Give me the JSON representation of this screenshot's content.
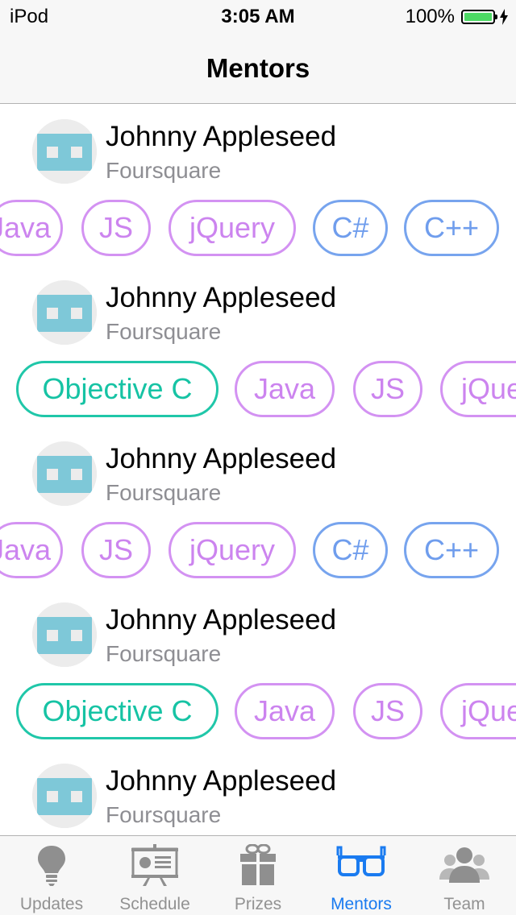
{
  "status_bar": {
    "carrier": "iPod",
    "time": "3:05 AM",
    "battery_percent": "100%",
    "battery_level": 1.0,
    "battery_color": "#4cd964"
  },
  "nav": {
    "title": "Mentors"
  },
  "mentors": [
    {
      "name": "Johnny Appleseed",
      "company": "Foursquare"
    },
    {
      "name": "Johnny Appleseed",
      "company": "Foursquare"
    },
    {
      "name": "Johnny Appleseed",
      "company": "Foursquare"
    },
    {
      "name": "Johnny Appleseed",
      "company": "Foursquare"
    },
    {
      "name": "Johnny Appleseed",
      "company": "Foursquare"
    }
  ],
  "tag_rows": [
    {
      "tags": [
        {
          "label": "Java",
          "color": "purple"
        },
        {
          "label": "JS",
          "color": "purple"
        },
        {
          "label": "jQuery",
          "color": "purple"
        },
        {
          "label": "C#",
          "color": "blue"
        },
        {
          "label": "C++",
          "color": "blue"
        }
      ]
    },
    {
      "tags": [
        {
          "label": "Objective C",
          "color": "teal"
        },
        {
          "label": "Java",
          "color": "purple"
        },
        {
          "label": "JS",
          "color": "purple"
        },
        {
          "label": "jQuery",
          "color": "purple"
        }
      ]
    },
    {
      "tags": [
        {
          "label": "Java",
          "color": "purple"
        },
        {
          "label": "JS",
          "color": "purple"
        },
        {
          "label": "jQuery",
          "color": "purple"
        },
        {
          "label": "C#",
          "color": "blue"
        },
        {
          "label": "C++",
          "color": "blue"
        }
      ]
    },
    {
      "tags": [
        {
          "label": "Objective C",
          "color": "teal"
        },
        {
          "label": "Java",
          "color": "purple"
        },
        {
          "label": "JS",
          "color": "purple"
        },
        {
          "label": "jQuery",
          "color": "purple"
        }
      ]
    }
  ],
  "tabs": [
    {
      "label": "Updates",
      "icon": "lightbulb-icon",
      "active": false
    },
    {
      "label": "Schedule",
      "icon": "presentation-board-icon",
      "active": false
    },
    {
      "label": "Prizes",
      "icon": "gift-icon",
      "active": false
    },
    {
      "label": "Mentors",
      "icon": "glasses-icon",
      "active": true
    },
    {
      "label": "Team",
      "icon": "people-icon",
      "active": false
    }
  ],
  "colors": {
    "tag_purple": "#cc84ef",
    "tag_blue": "#6f9ded",
    "tag_teal": "#16c3a4",
    "avatar_blue": "#7ec8d8",
    "tab_active": "#1a7bf0",
    "tab_inactive": "#929292"
  }
}
